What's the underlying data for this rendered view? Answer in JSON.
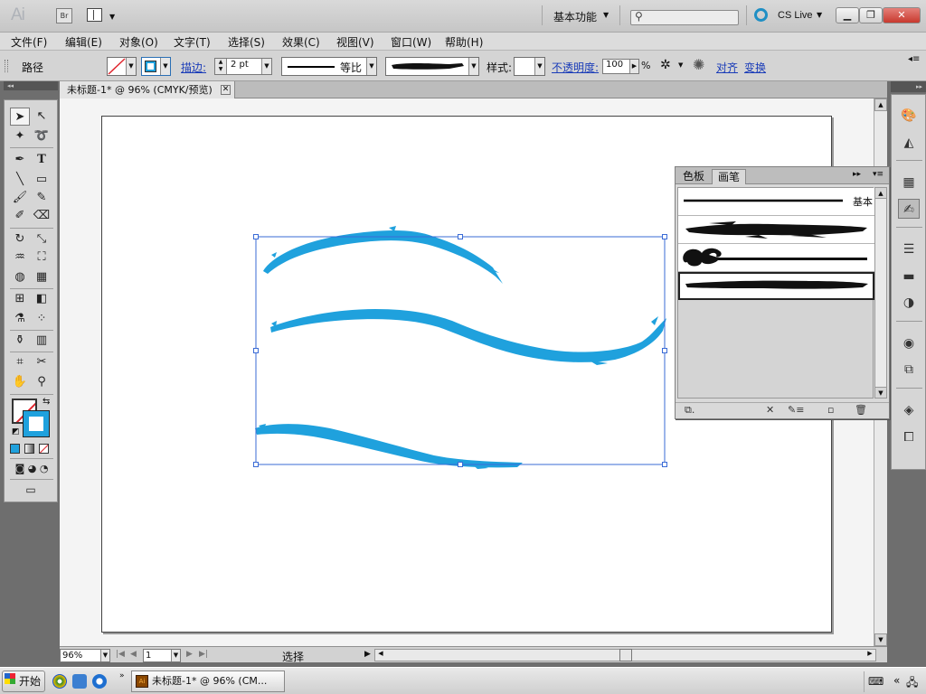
{
  "app": {
    "logo": "Ai",
    "bridge_button": "Br",
    "workspace": "基本功能",
    "search_placeholder": "",
    "cs_live": "CS Live"
  },
  "menu": [
    "文件(F)",
    "编辑(E)",
    "对象(O)",
    "文字(T)",
    "选择(S)",
    "效果(C)",
    "视图(V)",
    "窗口(W)",
    "帮助(H)"
  ],
  "control_bar": {
    "selection_label": "路径",
    "stroke_link": "描边:",
    "stroke_weight": "2 pt",
    "profile_value": "等比",
    "style_label": "样式:",
    "opacity_link": "不透明度:",
    "opacity_value": "100",
    "percent": "%",
    "align_link": "对齐",
    "transform_link": "变换"
  },
  "document": {
    "tab_title": "未标题-1* @ 96% (CMYK/预览)",
    "tab_close": "✕"
  },
  "status_bar": {
    "zoom": "96%",
    "page": "1",
    "status_text": "选择"
  },
  "brushes_panel": {
    "tabs": [
      "色板",
      "画笔"
    ],
    "active_tab": "画笔",
    "brushes": [
      "基本",
      "charcoal-brush",
      "ornament-brush",
      "dry-ink-brush"
    ],
    "basic_label": "基本",
    "selected_index": 3
  },
  "taskbar": {
    "start": "开始",
    "task_label": "未标题-1* @ 96% (CM..."
  },
  "colors": {
    "accent_blue": "#1fa1dd",
    "stroke_blue": "#1fa1dd",
    "link_blue": "#1a3cb8",
    "selection_blue": "#3a6bd6",
    "none_red": "#e0262e"
  },
  "icons": {
    "tools": [
      "selection-icon",
      "direct-selection-icon",
      "magic-wand-icon",
      "lasso-icon",
      "pen-icon",
      "type-icon",
      "line-icon",
      "rectangle-icon",
      "paintbrush-icon",
      "pencil-icon",
      "blob-brush-icon",
      "eraser-icon",
      "rotate-icon",
      "scale-icon",
      "warp-icon",
      "free-transform-icon",
      "shape-builder-icon",
      "perspective-icon",
      "mesh-icon",
      "gradient-icon",
      "eyedropper-icon",
      "blend-icon",
      "symbol-sprayer-icon",
      "column-graph-icon",
      "artboard-icon",
      "slice-icon",
      "hand-icon",
      "zoom-icon"
    ],
    "dock": [
      "color-icon",
      "color-guide-icon",
      "swatches-icon",
      "brushes-icon",
      "stroke-icon",
      "gradient-icon",
      "transparency-icon",
      "appearance-icon",
      "graphic-styles-icon",
      "layers-icon",
      "artboards-icon"
    ]
  }
}
